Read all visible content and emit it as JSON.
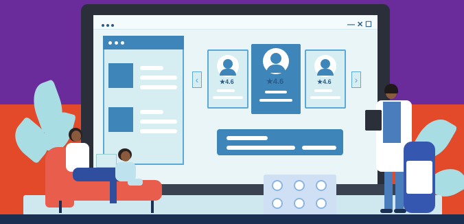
{
  "window": {
    "controls": [
      "—",
      "✕",
      "☐"
    ]
  },
  "doctor_cards": [
    {
      "rating": "4.6"
    },
    {
      "rating": "4.6"
    },
    {
      "rating": "4.6"
    }
  ],
  "colors": {
    "background_top": "#6a2c9a",
    "background_bottom": "#e24a2a",
    "accent_blue": "#3e86b9",
    "panel_light": "#d6edf2"
  },
  "icons": {
    "rating": "star-icon",
    "nav_prev": "chevron-left-icon",
    "nav_next": "chevron-right-icon"
  }
}
